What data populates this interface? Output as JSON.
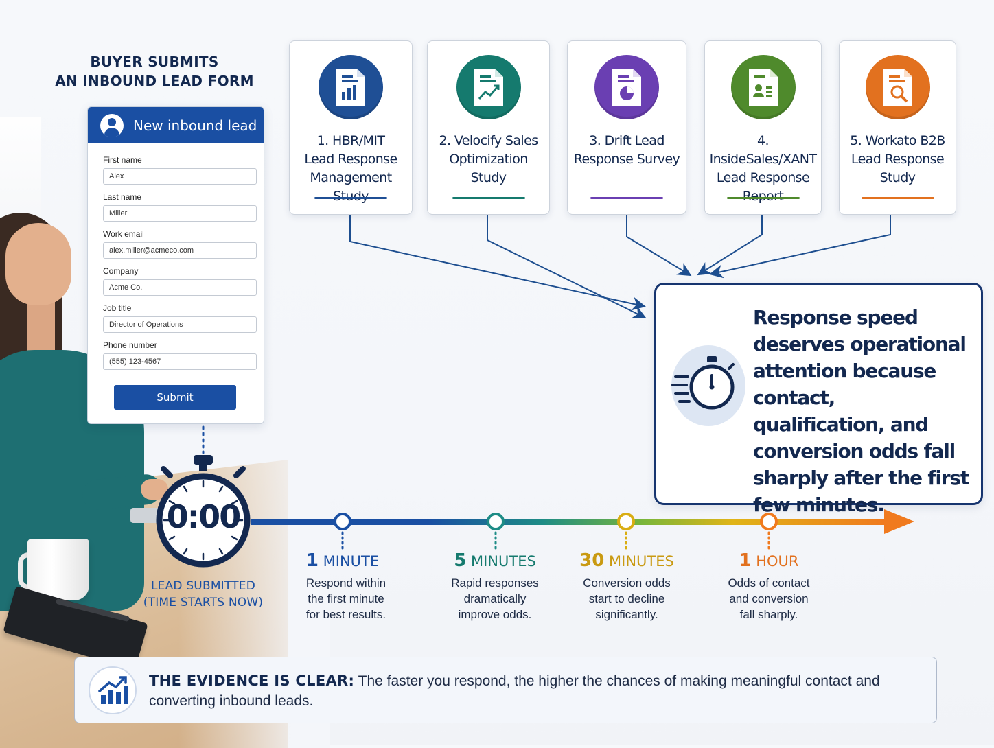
{
  "form": {
    "heading_line1": "BUYER SUBMITS",
    "heading_line2": "AN INBOUND LEAD FORM",
    "title": "New inbound lead",
    "fields": [
      {
        "label": "First name",
        "value": "Alex"
      },
      {
        "label": "Last name",
        "value": "Miller"
      },
      {
        "label": "Work email",
        "value": "alex.miller@acmeco.com"
      },
      {
        "label": "Company",
        "value": "Acme Co."
      },
      {
        "label": "Job title",
        "value": "Director of Operations"
      },
      {
        "label": "Phone number",
        "value": "(555) 123-4567"
      }
    ],
    "submit_label": "Submit"
  },
  "studies": [
    {
      "lines": [
        "1. HBR/MIT",
        "Lead Response",
        "Management Study"
      ],
      "color": "#1f4f95",
      "icon": "bar-chart-document-icon"
    },
    {
      "lines": [
        "2. Velocify Sales",
        "Optimization Study"
      ],
      "color": "#157a6e",
      "icon": "trend-chart-document-icon"
    },
    {
      "lines": [
        "3. Drift Lead",
        "Response Survey"
      ],
      "color": "#6a3fb2",
      "icon": "pie-chart-document-icon"
    },
    {
      "lines": [
        "4. InsideSales/XANT",
        "Lead Response",
        "Report"
      ],
      "color": "#4f8a2c",
      "icon": "profile-report-icon"
    },
    {
      "lines": [
        "5. Workato B2B",
        "Lead Response",
        "Study"
      ],
      "color": "#e2711f",
      "icon": "magnifier-document-icon"
    }
  ],
  "conclusion": {
    "text": "Response speed deserves operational attention because contact, qualification, and conversion odds fall sharply after the first few minutes."
  },
  "timer": {
    "readout": "0:00",
    "caption_line1": "LEAD SUBMITTED",
    "caption_line2": "(TIME STARTS NOW)"
  },
  "milestones": [
    {
      "num": "1",
      "unit": "MINUTE",
      "color": "#1a4fa3",
      "desc": [
        "Respond within",
        "the first minute",
        "for best results."
      ]
    },
    {
      "num": "5",
      "unit": "MINUTES",
      "color": "#157a6e",
      "desc": [
        "Rapid responses",
        "dramatically",
        "improve odds."
      ]
    },
    {
      "num": "30",
      "unit": "MINUTES",
      "color": "#c99a12",
      "desc": [
        "Conversion odds",
        "start to decline",
        "significantly."
      ]
    },
    {
      "num": "1",
      "unit": "HOUR",
      "color": "#e2711f",
      "desc": [
        "Odds of contact",
        "and conversion",
        "fall sharply."
      ]
    }
  ],
  "evidence": {
    "lead": "THE EVIDENCE IS CLEAR:",
    "body": " The faster you respond, the higher the chances of making meaningful contact and converting inbound leads."
  },
  "colors": {
    "navy": "#13284f",
    "brand_blue": "#1a4fa3",
    "arrow_blue": "#1d4e8f"
  }
}
